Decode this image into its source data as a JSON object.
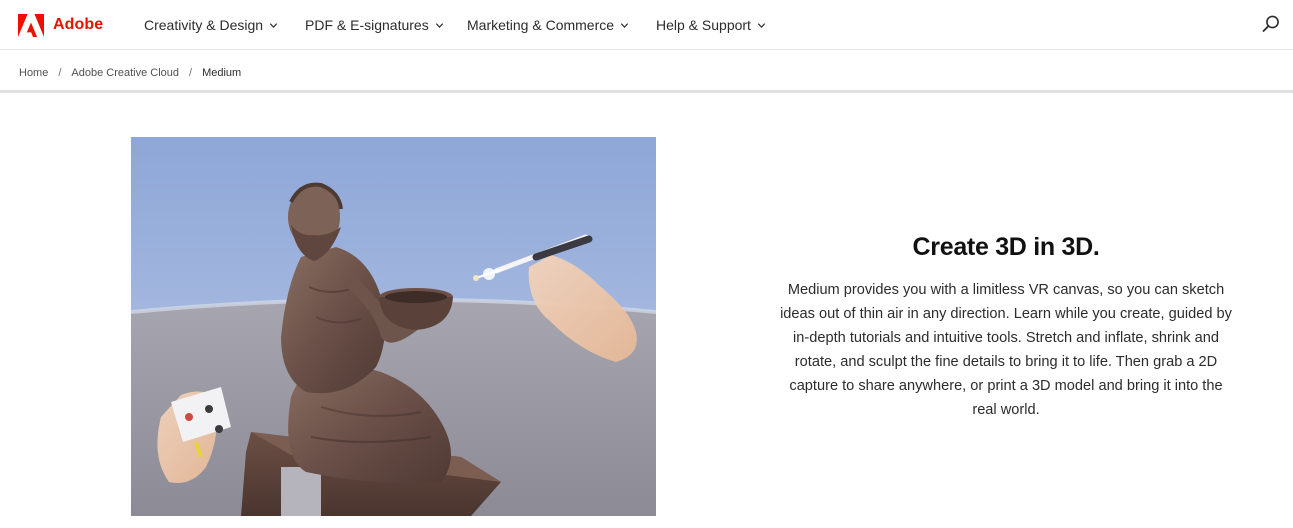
{
  "brand": {
    "name": "Adobe",
    "logo_icon": "adobe-logo-icon",
    "color": "#eb1000"
  },
  "nav": {
    "items": [
      {
        "label": "Creativity & Design"
      },
      {
        "label": "PDF & E-signatures"
      },
      {
        "label": "Marketing & Commerce"
      },
      {
        "label": "Help & Support"
      }
    ],
    "search_icon": "search-icon"
  },
  "breadcrumb": {
    "items": [
      {
        "label": "Home"
      },
      {
        "label": "Adobe Creative Cloud"
      }
    ],
    "separator": "/",
    "current": "Medium"
  },
  "hero": {
    "image": "vr-sculpture-image",
    "title": "Create 3D in 3D.",
    "body": "Medium provides you with a limitless VR canvas, so you can sketch ideas out of thin air in any direction. Learn while you create, guided by in-depth tutorials and intuitive tools. Stretch and inflate, shrink and rotate, and sculpt the fine details to bring it to life. Then grab a 2D capture to share anywhere, or print a 3D model and bring it into the real world."
  }
}
